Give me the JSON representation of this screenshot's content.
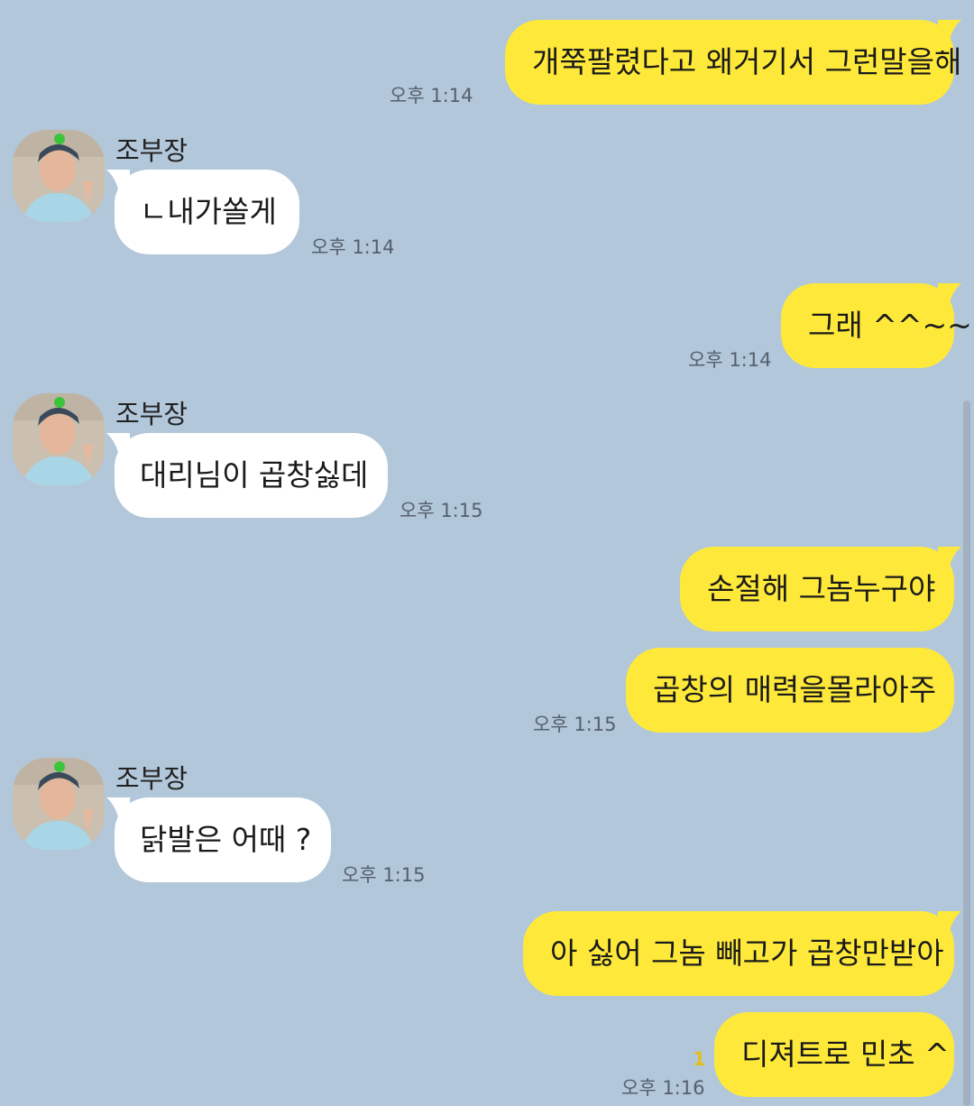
{
  "colors": {
    "background": "#b2c7da",
    "my_bubble": "#fee93a",
    "their_bubble": "#ffffff",
    "timestamp": "#55606d"
  },
  "messages": [
    {
      "side": "me",
      "text": "개쭉팔렸다고 왜거기서 그런말을해",
      "time": "오후 1:14"
    },
    {
      "side": "them",
      "sender": "조부장",
      "text": "ㄴ내가쏠게",
      "time": "오후 1:14"
    },
    {
      "side": "me",
      "text": "그래 ^^~~",
      "time": "오후 1:14"
    },
    {
      "side": "them",
      "sender": "조부장",
      "text": "대리님이 곱창싫데",
      "time": "오후 1:15"
    },
    {
      "side": "me",
      "text": "손절해 그놈누구야"
    },
    {
      "side": "me",
      "text": "곱창의 매력을몰라아주",
      "time": "오후 1:15"
    },
    {
      "side": "them",
      "sender": "조부장",
      "text": "닭발은 어때 ?",
      "time": "오후 1:15"
    },
    {
      "side": "me",
      "text": "아 싫어 그놈 빼고가 곱창만받아"
    },
    {
      "side": "me",
      "text": "디져트로 민초 ^",
      "time": "오후 1:16",
      "unread": "1"
    }
  ]
}
